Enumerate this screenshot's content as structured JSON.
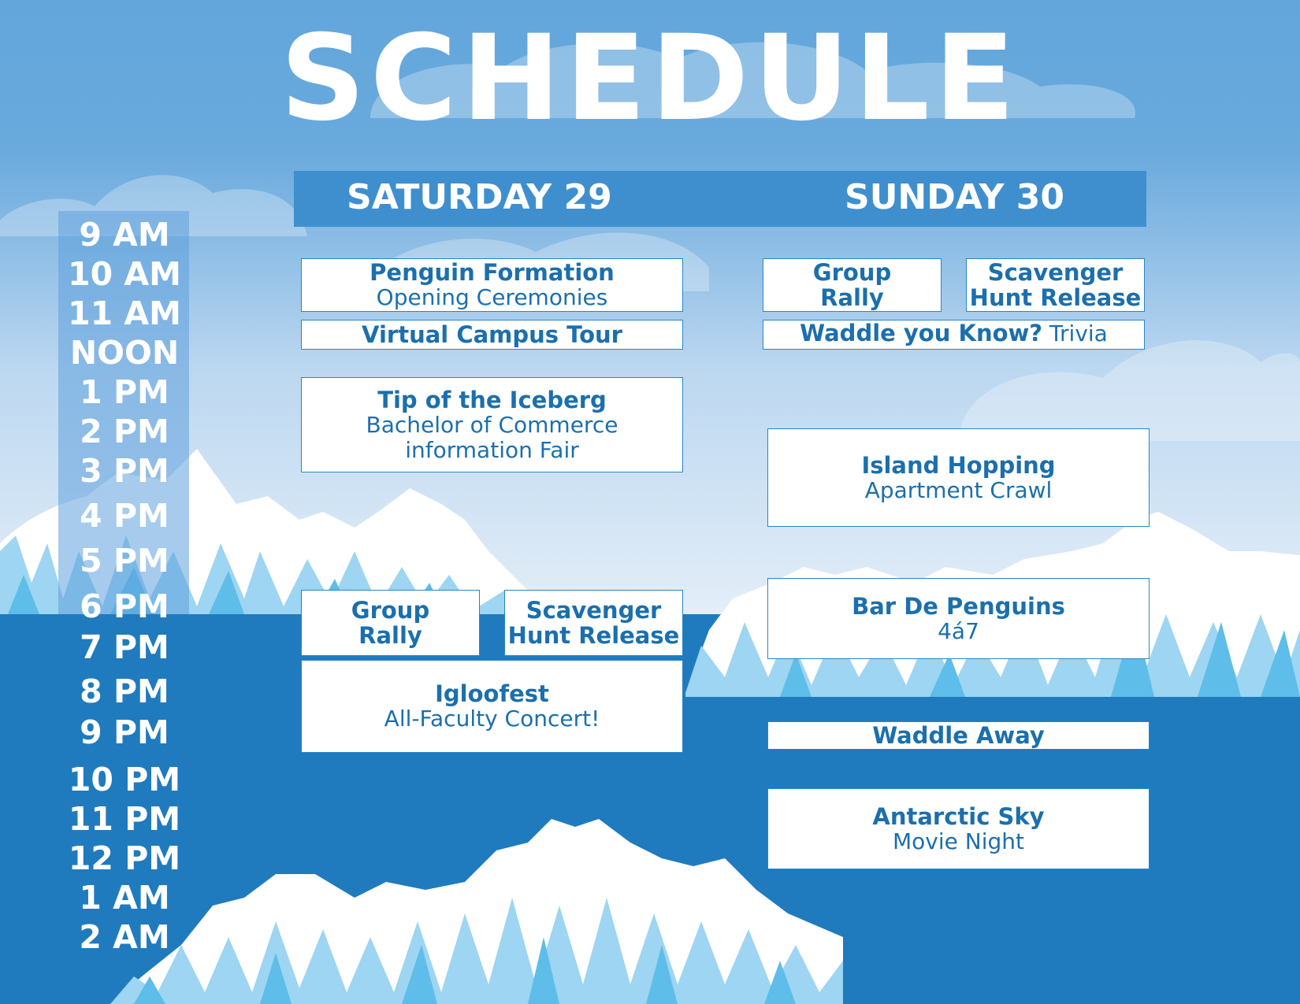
{
  "title": "SCHEDULE",
  "days": [
    "SATURDAY 29",
    "SUNDAY 30"
  ],
  "times": [
    "9 AM",
    "10 AM",
    "11 AM",
    "NOON",
    "1 PM",
    "2 PM",
    "3 PM",
    "4 PM",
    "5 PM",
    "6 PM",
    "7 PM",
    "8 PM",
    "9 PM",
    "10 PM",
    "11 PM",
    "12 PM",
    "1 AM",
    "2 AM"
  ],
  "saturday": {
    "penguin_formation": {
      "title": "Penguin Formation",
      "sub": "Opening Ceremonies"
    },
    "virtual_tour": {
      "title": "Virtual Campus Tour"
    },
    "tip_iceberg": {
      "title": "Tip of the Iceberg",
      "sub1": "Bachelor of Commerce",
      "sub2": "information Fair"
    },
    "group_rally": {
      "line1": "Group",
      "line2": "Rally"
    },
    "scavenger": {
      "line1": "Scavenger",
      "line2": "Hunt Release"
    },
    "igloofest": {
      "title": "Igloofest",
      "sub": "All-Faculty Concert!"
    }
  },
  "sunday": {
    "group_rally": {
      "line1": "Group",
      "line2": "Rally"
    },
    "scavenger": {
      "line1": "Scavenger",
      "line2": "Hunt Release"
    },
    "waddle_trivia": {
      "title": "Waddle you Know?",
      "sub": " Trivia"
    },
    "island_hopping": {
      "title": "Island Hopping",
      "sub": "Apartment Crawl"
    },
    "bar_de_penguins": {
      "title": "Bar De Penguins",
      "sub": "4á7"
    },
    "waddle_away": {
      "title": "Waddle Away"
    },
    "antarctic_sky": {
      "title": "Antarctic Sky",
      "sub": "Movie Night"
    }
  },
  "colors": {
    "sky_top": "#69a9dc",
    "sky_bottom": "#cfe3f4",
    "water": "#1f7bbe",
    "day_band": "#3f8fcf",
    "event_text": "#1b6fad",
    "ice_white": "#ffffff",
    "ice_light": "#9dd5f2",
    "ice_mid": "#5ebde9"
  }
}
